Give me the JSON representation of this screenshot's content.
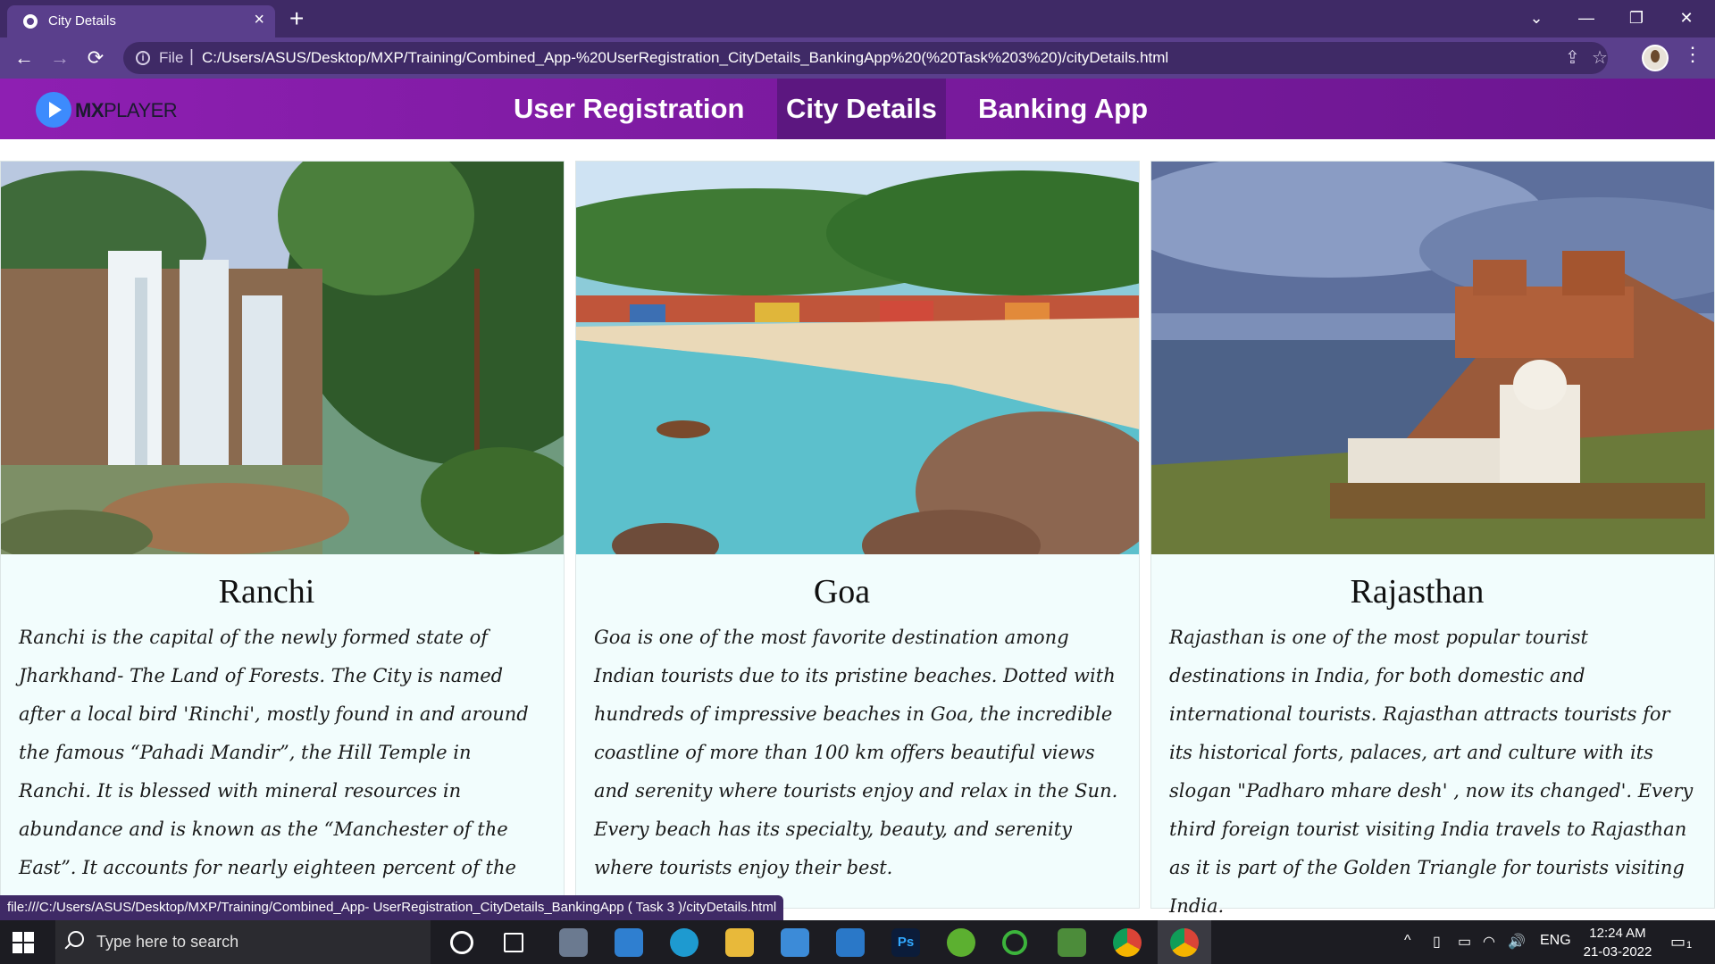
{
  "browser": {
    "tab_title": "City Details",
    "tab_close": "×",
    "new_tab": "+",
    "scheme": "File",
    "separator": "|",
    "url": "C:/Users/ASUS/Desktop/MXP/Training/Combined_App-%20UserRegistration_CityDetails_BankingApp%20(%20Task%203%20)/cityDetails.html",
    "status_url": "file:///C:/Users/ASUS/Desktop/MXP/Training/Combined_App- UserRegistration_CityDetails_BankingApp ( Task 3 )/cityDetails.html",
    "controls": {
      "tab_search": "⌄",
      "minimize": "—",
      "restore": "❐",
      "close": "✕"
    },
    "nav": {
      "back": "←",
      "forward": "→",
      "reload": "⟳"
    },
    "info": "i",
    "share": "⇪",
    "bookmark": "☆",
    "menu": "⋮"
  },
  "site": {
    "logo_bold": "MX",
    "logo_light": "PLAYER",
    "nav": [
      {
        "label": "User Registration"
      },
      {
        "label": "City Details",
        "active": true
      },
      {
        "label": "Banking App"
      }
    ]
  },
  "cities": [
    {
      "name": "Ranchi",
      "image": "waterfall-image",
      "text": "Ranchi is the capital of the newly formed state of Jharkhand- The Land of Forests. The City is named after a local bird 'Rinchi', mostly found in and around the famous “Pahadi Mandir”, the Hill Temple in Ranchi. It is blessed with mineral resources in abundance and is known as the “Manchester of the East”. It accounts for nearly eighteen percent of the national mineral production."
    },
    {
      "name": "Goa",
      "image": "beach-image",
      "text": "Goa is one of the most favorite destination among Indian tourists due to its pristine beaches. Dotted with hundreds of impressive beaches in Goa, the incredible coastline of more than 100 km offers beautiful views and serenity where tourists enjoy and relax in the Sun. Every beach has its specialty, beauty, and serenity where tourists enjoy their best."
    },
    {
      "name": "Rajasthan",
      "image": "fort-image",
      "text": "Rajasthan is one of the most popular tourist destinations in India, for both domestic and international tourists. Rajasthan attracts tourists for its historical forts, palaces, art and culture with its slogan \"Padharo mhare desh' , now its changed'. Every third foreign tourist visiting India travels to Rajasthan as it is part of the Golden Triangle for tourists visiting India."
    }
  ],
  "taskbar": {
    "search_placeholder": "Type here to search",
    "lang": "ENG",
    "time": "12:24 AM",
    "date": "21-03-2022",
    "notification_count": "1",
    "apps": [
      "cortana-icon",
      "task-view-icon",
      "camera-icon",
      "media-player-icon",
      "edge-icon",
      "file-explorer-icon",
      "store-icon",
      "mail-icon",
      "photoshop-icon",
      "app-green-icon",
      "app-ring-icon",
      "app-image-icon",
      "chrome-icon",
      "chrome-active-icon"
    ],
    "photoshop_label": "Ps",
    "tray": {
      "chevron": "^",
      "battery": "▭",
      "volume": "🔊"
    }
  },
  "colors": {
    "nav_gradient_start": "#8e1fb2",
    "nav_active": "#5c1780",
    "card_bg": "#f2fdfd",
    "browser_frame": "#3f2a66"
  }
}
